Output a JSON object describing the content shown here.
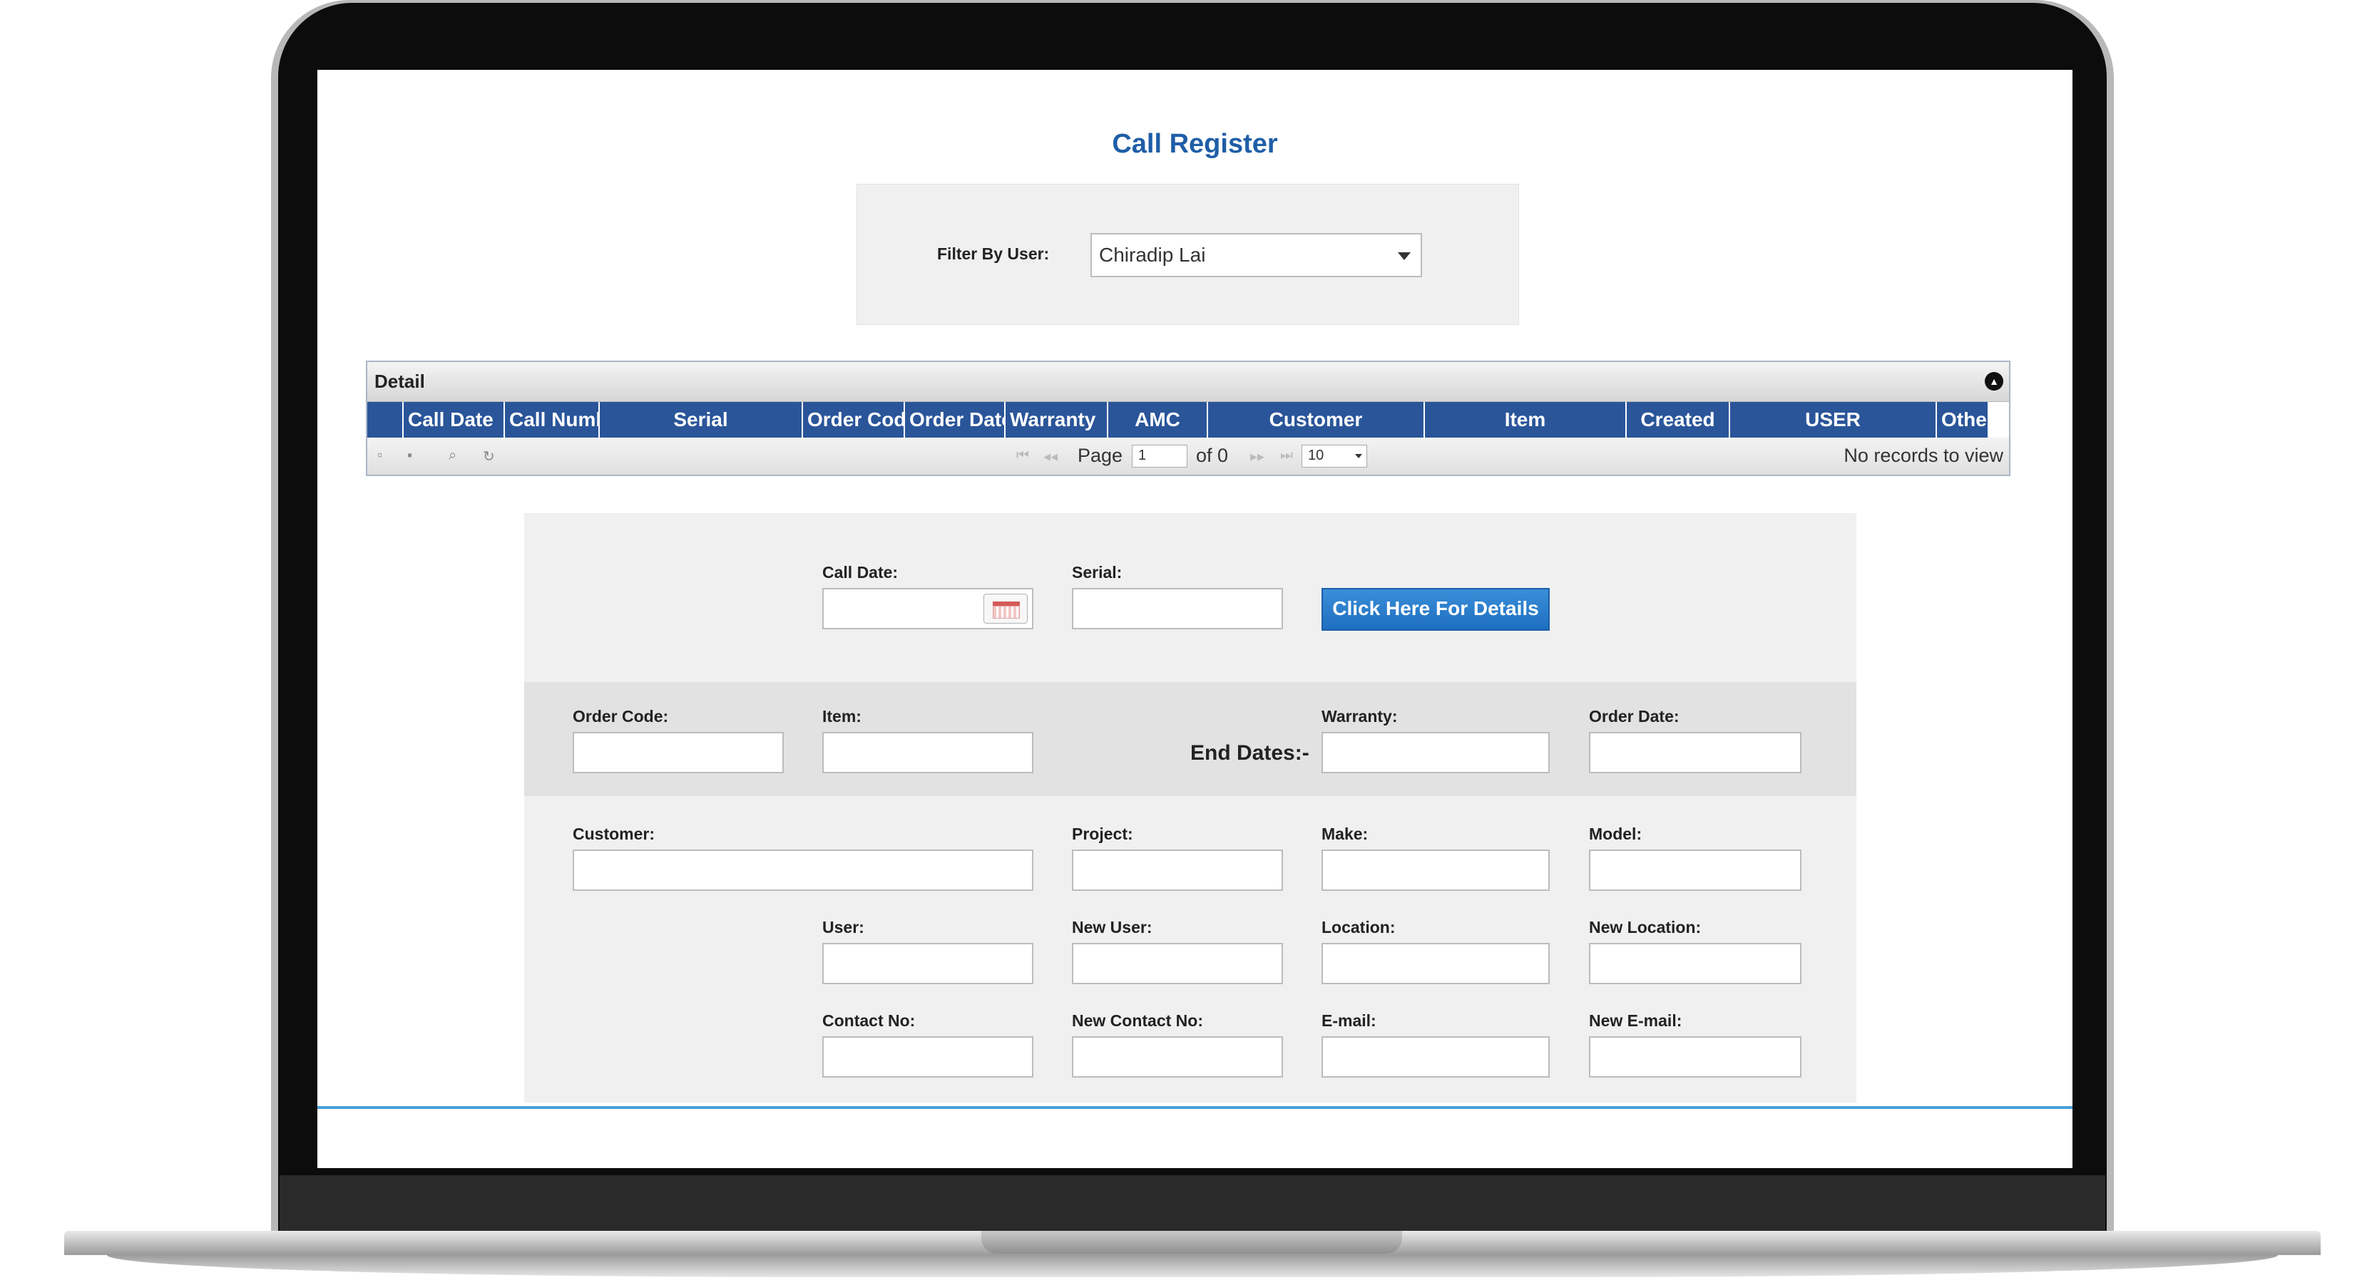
{
  "page": {
    "title": "Call Register"
  },
  "filter": {
    "label": "Filter By User:",
    "selected": "Chiradip Lai"
  },
  "grid": {
    "caption": "Detail",
    "columns": [
      "Call Date",
      "Call Number",
      "Serial",
      "Order Code",
      "Order Date",
      "Warranty",
      "AMC",
      "Customer",
      "Item",
      "Created",
      "USER",
      "Others"
    ],
    "pager": {
      "page_label": "Page",
      "page_value": "1",
      "of_label": "of 0",
      "rows_value": "10",
      "empty_text": "No records to view"
    }
  },
  "form": {
    "call_date_label": "Call Date:",
    "serial_label": "Serial:",
    "details_button": "Click Here For Details",
    "order_code_label": "Order Code:",
    "item_label": "Item:",
    "end_dates_label": "End Dates:-",
    "warranty_label": "Warranty:",
    "order_date_label": "Order Date:",
    "customer_label": "Customer:",
    "project_label": "Project:",
    "make_label": "Make:",
    "model_label": "Model:",
    "user_label": "User:",
    "new_user_label": "New User:",
    "location_label": "Location:",
    "new_location_label": "New Location:",
    "contact_no_label": "Contact No:",
    "new_contact_no_label": "New Contact No:",
    "email_label": "E-mail:",
    "new_email_label": "New E-mail:"
  },
  "icons": {
    "collapse": "circle-chevron-up-icon",
    "add": "add-record-icon",
    "delete": "trash-icon",
    "search": "search-icon",
    "refresh": "refresh-icon",
    "calendar": "calendar-icon"
  },
  "colors": {
    "title": "#1f5ea8",
    "grid_header": "#2a5599",
    "button": "#1e6fc0"
  }
}
